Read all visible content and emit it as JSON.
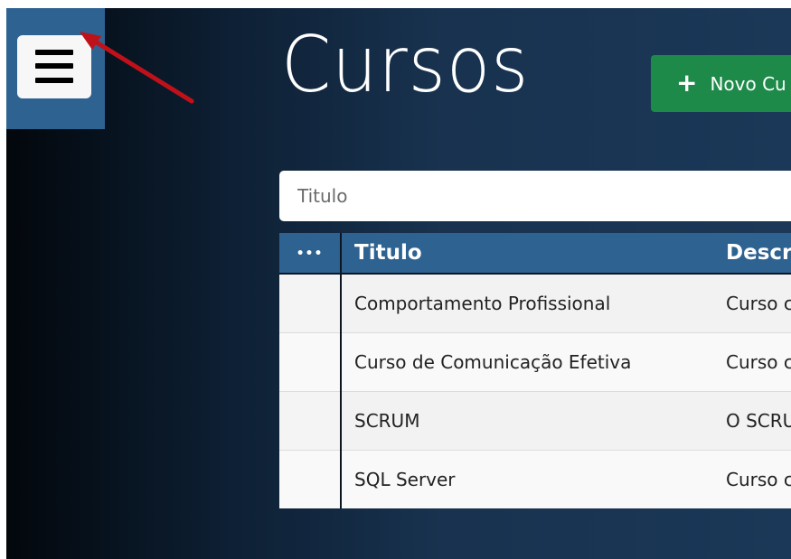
{
  "sidebar": {
    "menu_icon": "hamburger-menu-icon"
  },
  "header": {
    "title": "Cursos",
    "new_button": {
      "icon": "plus-icon",
      "label": "Novo Cu"
    }
  },
  "search": {
    "placeholder": "Titulo",
    "value": ""
  },
  "table": {
    "columns": [
      {
        "label": "•••",
        "icon": "more-dots-icon"
      },
      {
        "label": "Titulo"
      },
      {
        "label": "Descr"
      }
    ],
    "rows": [
      {
        "titulo": "Comportamento Profissional",
        "descricao": "Curso c"
      },
      {
        "titulo": "Curso de Comunicação Efetiva",
        "descricao": "Curso c"
      },
      {
        "titulo": "SCRUM",
        "descricao": "O SCRU"
      },
      {
        "titulo": "SQL Server",
        "descricao": "Curso c"
      }
    ]
  },
  "colors": {
    "sidebar_panel": "#2e6291",
    "table_header": "#2e6291",
    "new_button": "#1e8a4a",
    "annotation_arrow": "#c0111a"
  }
}
